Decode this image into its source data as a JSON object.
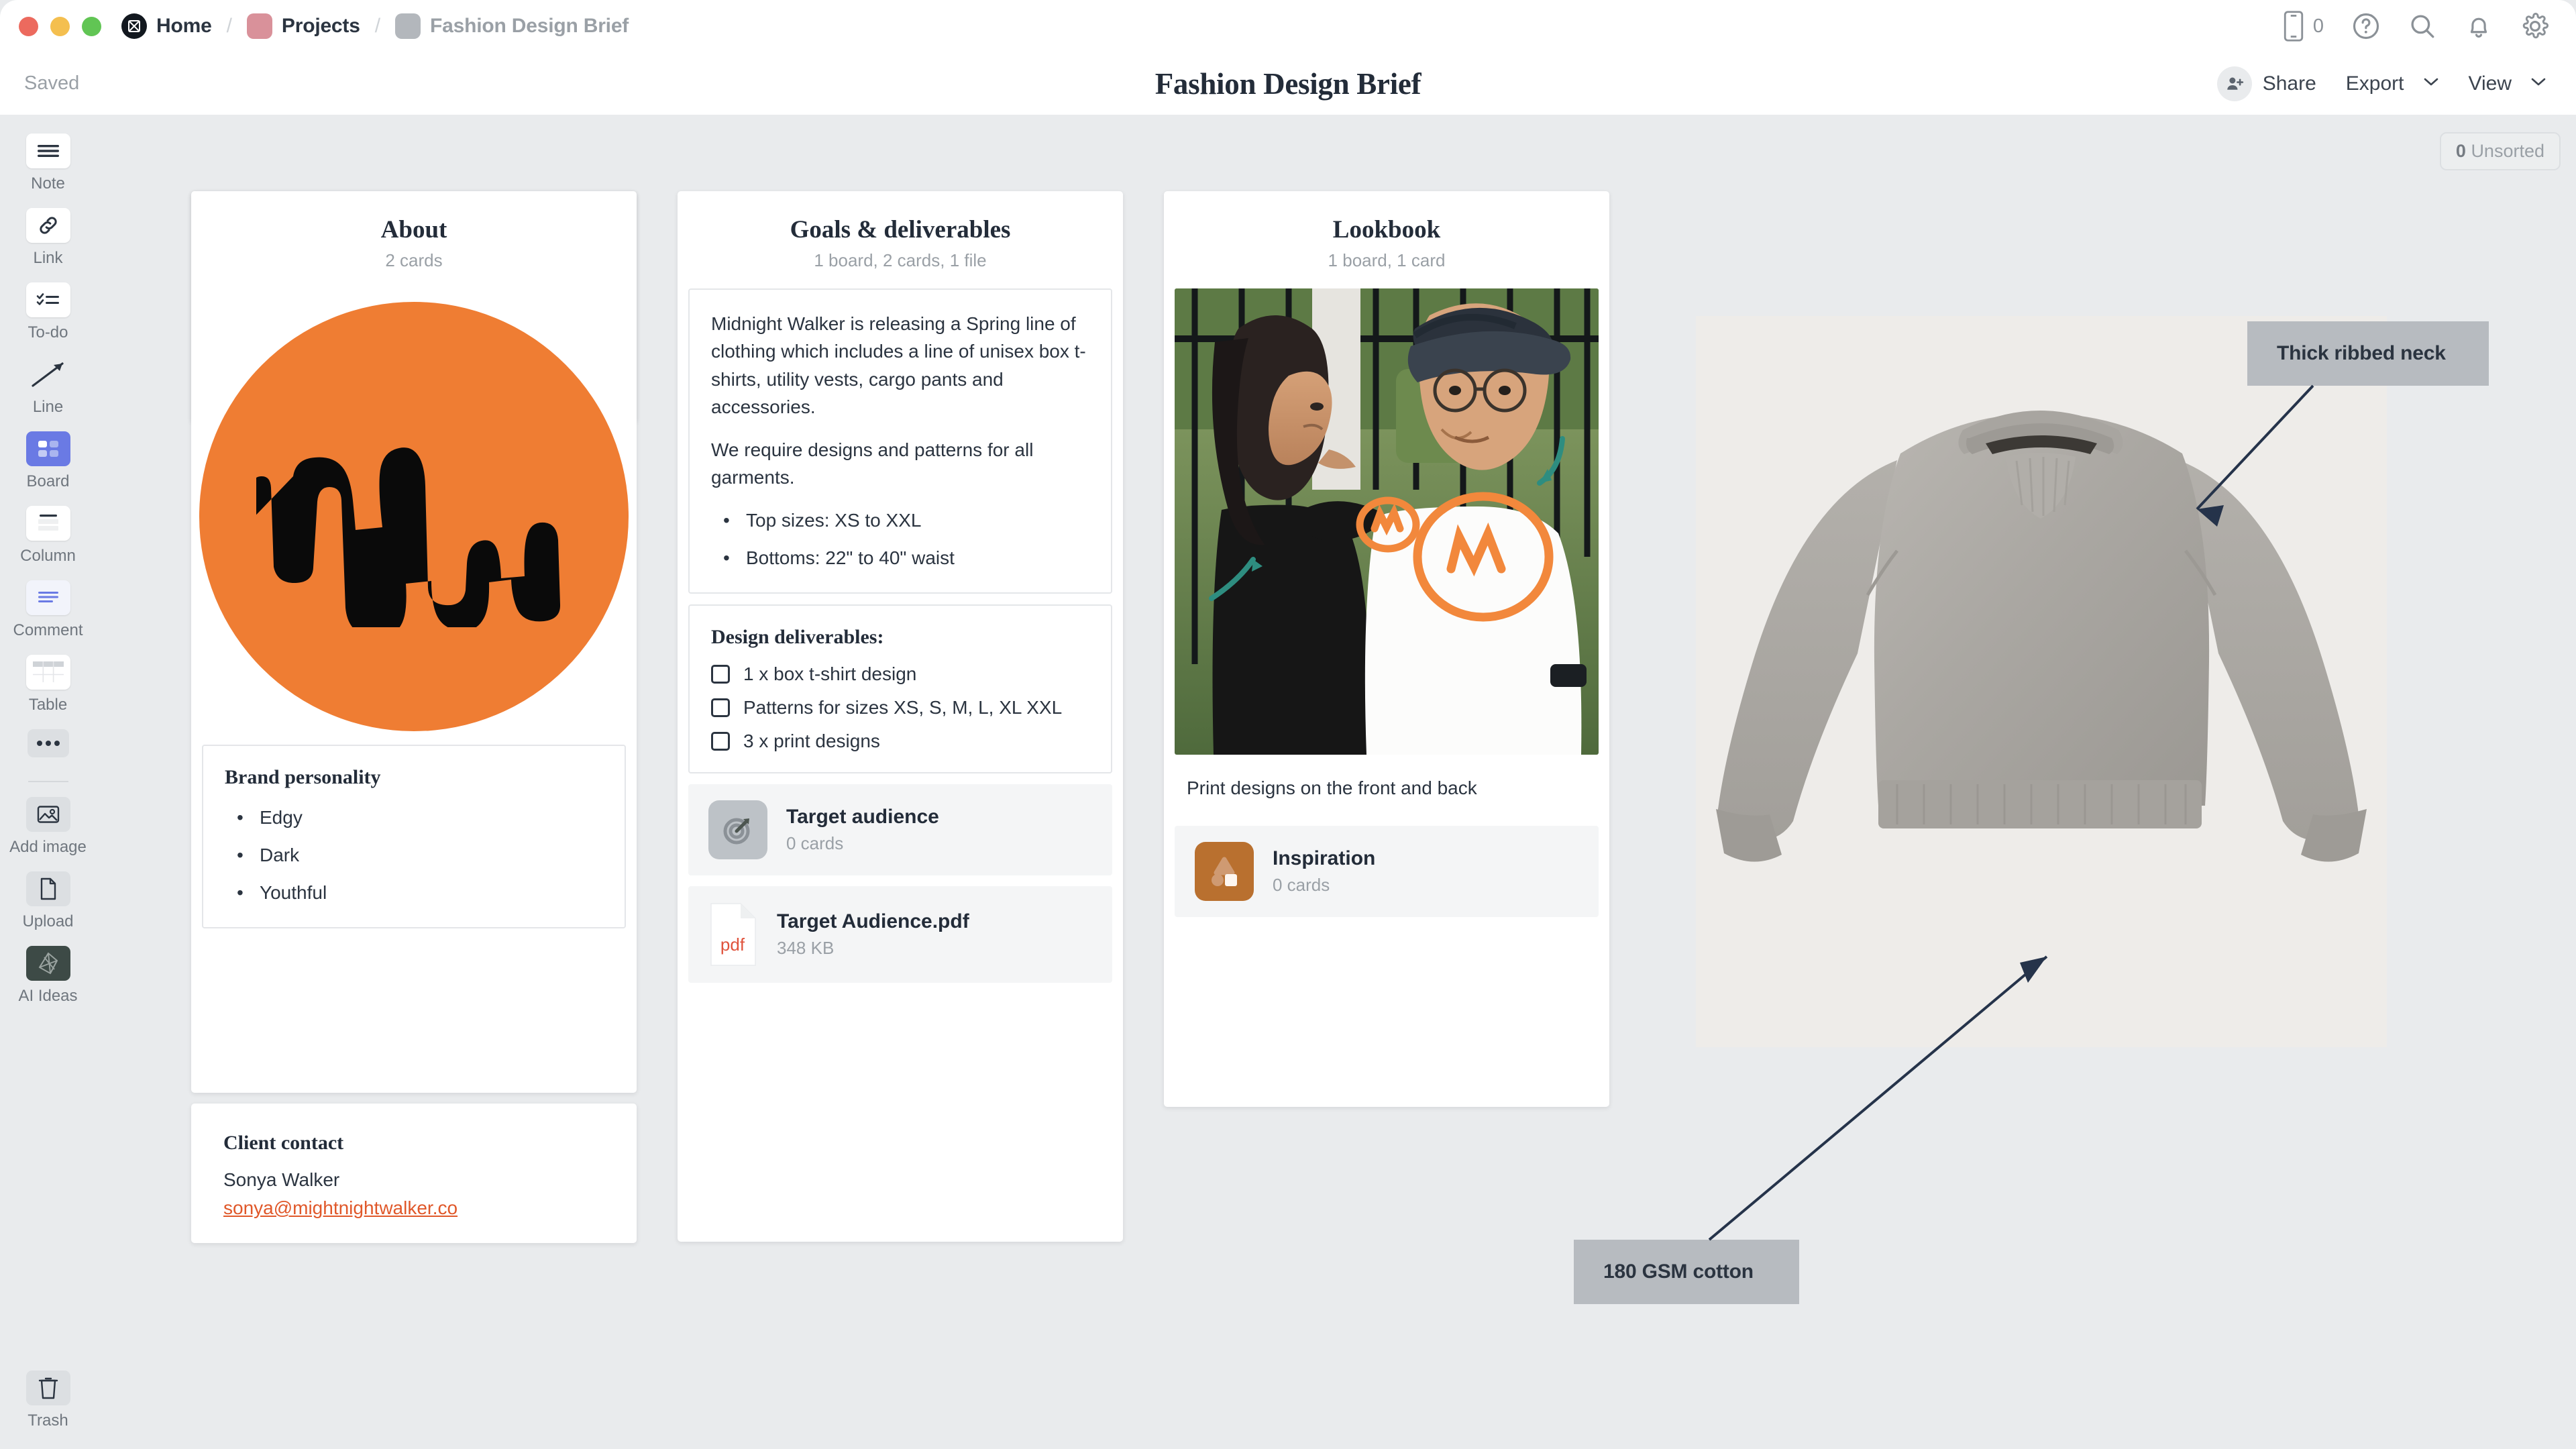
{
  "window": {
    "traffic_lights": [
      "close",
      "minimize",
      "maximize"
    ]
  },
  "breadcrumb": {
    "items": [
      {
        "label": "Home",
        "icon": "milanote-logo-icon"
      },
      {
        "label": "Projects",
        "icon": "folder-chip-icon"
      },
      {
        "label": "Fashion Design Brief",
        "icon": "board-chip-icon"
      }
    ],
    "separator": "/"
  },
  "topbar_right": {
    "mobile_count": "0",
    "icons": [
      "mobile-icon",
      "help-icon",
      "search-icon",
      "notifications-icon",
      "settings-icon"
    ]
  },
  "toolbar": {
    "saved_label": "Saved",
    "title": "Fashion Design Brief",
    "share_label": "Share",
    "export_label": "Export",
    "view_label": "View"
  },
  "rail": {
    "tools": [
      {
        "label": "Note",
        "icon": "note-icon"
      },
      {
        "label": "Link",
        "icon": "link-icon"
      },
      {
        "label": "To-do",
        "icon": "todo-icon"
      },
      {
        "label": "Line",
        "icon": "line-arrow-icon"
      },
      {
        "label": "Board",
        "icon": "board-icon",
        "active": true
      },
      {
        "label": "Column",
        "icon": "column-icon"
      },
      {
        "label": "Comment",
        "icon": "comment-icon"
      },
      {
        "label": "Table",
        "icon": "table-icon"
      },
      {
        "label": "",
        "icon": "more-dots-icon"
      },
      {
        "label": "Add image",
        "icon": "add-image-icon"
      },
      {
        "label": "Upload",
        "icon": "upload-file-icon"
      },
      {
        "label": "AI Ideas",
        "icon": "ai-ideas-icon"
      }
    ],
    "trash_label": "Trash",
    "trash_icon": "trash-icon"
  },
  "canvas": {
    "unsorted_count": "0",
    "unsorted_label": "Unsorted"
  },
  "columns": [
    {
      "title": "About",
      "subtitle": "2 cards",
      "logo_alt": "MW monogram logo",
      "brand_personality": {
        "heading": "Brand personality",
        "items": [
          "Edgy",
          "Dark",
          "Youthful"
        ]
      },
      "client_contact": {
        "heading": "Client contact",
        "name": "Sonya Walker",
        "email": "sonya@mightnightwalker.co"
      }
    },
    {
      "title": "Goals & deliverables",
      "subtitle": "1 board, 2 cards, 1 file",
      "brief": {
        "paragraphs": [
          "Midnight Walker is releasing a Spring line of clothing which includes a line of unisex box t-shirts, utility vests, cargo pants and accessories.",
          "We require designs and patterns for all garments."
        ],
        "bullets": [
          "Top sizes: XS to XXL",
          "Bottoms: 22\" to 40\" waist"
        ]
      },
      "deliverables": {
        "heading": "Design deliverables:",
        "items": [
          {
            "label": "1 x box t-shirt design",
            "checked": false
          },
          {
            "label": "Patterns for sizes XS, S, M, L, XL XXL",
            "checked": false
          },
          {
            "label": "3 x print designs",
            "checked": false
          }
        ]
      },
      "board_row": {
        "title": "Target audience",
        "subtitle": "0 cards",
        "icon": "target-icon"
      },
      "file_row": {
        "title": "Target Audience.pdf",
        "subtitle": "348 KB",
        "icon": "pdf-file-icon",
        "badge": "pdf"
      }
    },
    {
      "title": "Lookbook",
      "subtitle": "1 board, 1 card",
      "photo_alt": "Two models wearing MW branded t-shirts outdoors",
      "caption": "Print designs on the front and back",
      "board_row": {
        "title": "Inspiration",
        "subtitle": "0 cards",
        "icon": "inspiration-shapes-icon"
      }
    }
  ],
  "annotations": [
    {
      "text": "Thick ribbed neck"
    },
    {
      "text": "180 GSM cotton"
    }
  ],
  "product_image": {
    "alt": "Grey cropped crewneck sweatshirt"
  },
  "colors": {
    "brand_orange": "#ef7d33",
    "accent_blue": "#6a7ae4",
    "link_orange": "#e0582a",
    "text_dark": "#232c39",
    "text_muted": "#9aa0a6",
    "canvas_bg": "#e9ebed",
    "annotation_bg": "#b7bbc0"
  }
}
